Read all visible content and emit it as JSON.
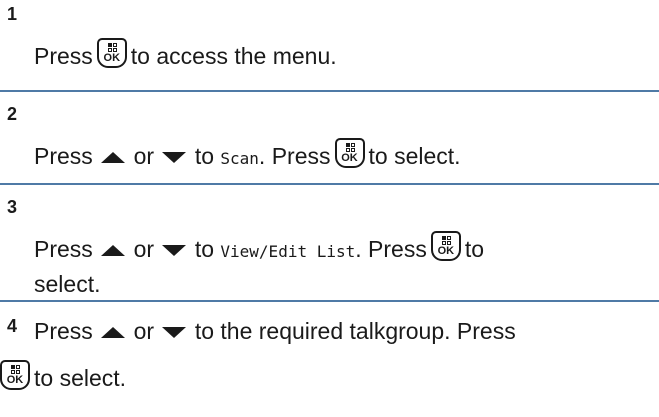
{
  "steps": [
    {
      "number": "1",
      "press": "Press",
      "rest": "to access the menu."
    },
    {
      "number": "2",
      "press": "Press",
      "or": "or",
      "to": "to",
      "menu_item": "Scan",
      "press_again": ". Press",
      "rest": "to select."
    },
    {
      "number": "3",
      "press": "Press",
      "or": "or",
      "to": "to",
      "menu_item": "View/Edit List",
      "press_again": ". Press",
      "rest_inline": "to",
      "rest_next_line": "select."
    },
    {
      "number": "4",
      "line1": "Press",
      "or": "or",
      "line1_end": "to the required talkgroup. Press",
      "line2": "to select."
    }
  ],
  "button": {
    "label": "OK"
  },
  "colors": {
    "separator": "#4f7aa6",
    "text": "#1a1a1a"
  },
  "icons": {
    "ok_button": "menu-ok-button-icon",
    "up": "up-arrow-icon",
    "down": "down-arrow-icon"
  }
}
